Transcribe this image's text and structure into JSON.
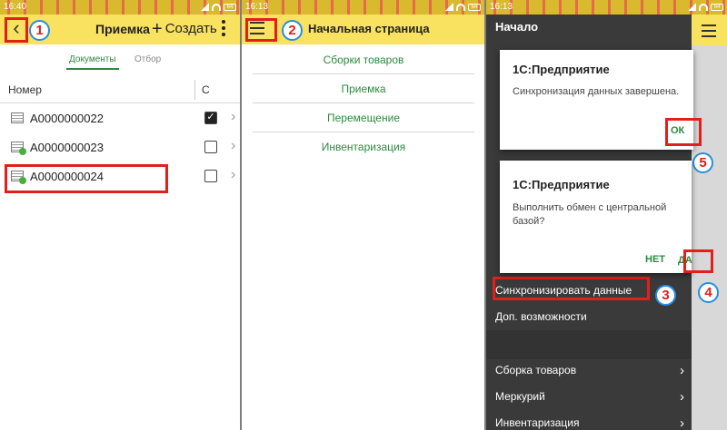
{
  "panel1": {
    "status": {
      "time": "16:40",
      "battery": "64"
    },
    "header": {
      "back_glyph": "‹",
      "title": "Приемка",
      "create_label": "Создать"
    },
    "tabs": {
      "documents": "Документы",
      "filter": "Отбор"
    },
    "table": {
      "col_number": "Номер",
      "col_check": "С",
      "rows": [
        {
          "number": "А0000000022",
          "checked": true
        },
        {
          "number": "А0000000023",
          "checked": false
        },
        {
          "number": "А0000000024",
          "checked": false
        }
      ]
    },
    "callouts": {
      "back": "1"
    }
  },
  "panel2": {
    "status": {
      "time": "16:13",
      "battery": "64"
    },
    "header": {
      "title": "Начальная страница"
    },
    "menu": [
      "Сборки товаров",
      "Приемка",
      "Перемещение",
      "Инвентаризация"
    ],
    "callouts": {
      "menu": "2"
    }
  },
  "panel3": {
    "status": {
      "time": "16:13",
      "battery": "64"
    },
    "drawer_title": "Начало",
    "dialog_sync": {
      "title": "1С:Предприятие",
      "text": "Синхронизация данных завершена.",
      "ok": "ОК"
    },
    "dialog_exchange": {
      "title": "1С:Предприятие",
      "text": "Выполнить обмен с центральной базой?",
      "no": "НЕТ",
      "yes": "ДА"
    },
    "menu_items": {
      "sync": "Синхронизировать данные",
      "extra": "Доп. возможности",
      "assembly": "Сборка товаров",
      "mercury": "Меркурий",
      "inventory": "Инвентаризация"
    },
    "callouts": {
      "sync": "3",
      "yes": "4",
      "ok": "5"
    }
  },
  "colors": {
    "accent_yellow": "#f8e25f",
    "highlight_red": "#e0201b",
    "green_text": "#2c8a3e",
    "callout_blue": "#2a8de0"
  }
}
